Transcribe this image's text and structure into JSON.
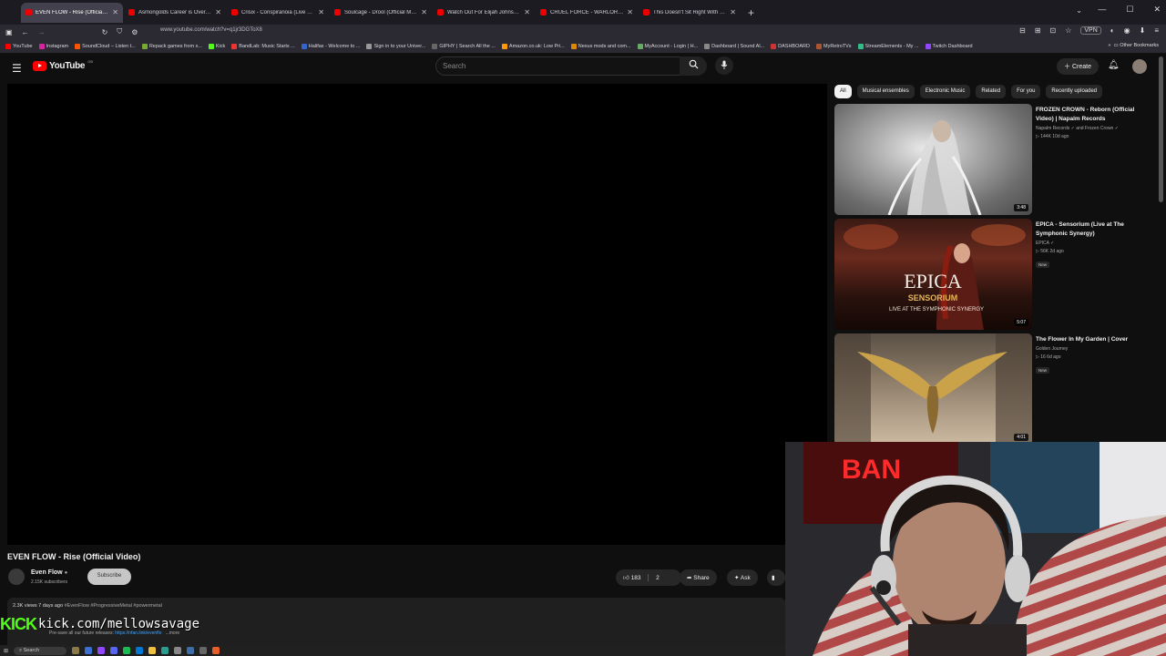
{
  "browser": {
    "tabs": [
      {
        "label": "EVEN FLOW - Rise (Official Vide",
        "active": true
      },
      {
        "label": "Asmongolds Career is Over... - Y"
      },
      {
        "label": "Crisix - Conspiranoia (Live From"
      },
      {
        "label": "Soulcage - Drool (Official Music"
      },
      {
        "label": "Watch Out For Elijah Johnson | "
      },
      {
        "label": "CRUEL FORCE - WARLORDS (O"
      },
      {
        "label": "This Doesn't Sit Right With Me"
      }
    ],
    "url": "www.youtube.com/watch?v=q1jr3DGToX8",
    "vpn_label": "VPN",
    "bookmarks": [
      "YouTube",
      "Instagram",
      "SoundCloud – Listen t...",
      "Repack games from x...",
      "Kick",
      "BandLab: Music Starts ...",
      "Halifax - Welcome to ...",
      "Sign in to your Univer...",
      "GIPHY | Search All the ...",
      "Amazon.co.uk: Low Pri...",
      "Nexus mods and com...",
      "MyAccount - Login | H...",
      "Dashboard | Sound Al...",
      "DASHBOARD",
      "MyRetroTVs",
      "StreamElements - My ...",
      "Twitch Dashboard"
    ],
    "other_bookmarks": "Other Bookmarks"
  },
  "youtube": {
    "logo_text": "YouTube",
    "logo_region": "GB",
    "search_placeholder": "Search",
    "create_label": "Create"
  },
  "video": {
    "title": "EVEN FLOW - Rise (Official Video)",
    "channel": "Even Flow",
    "subscribers": "2.15K subscribers",
    "subscribe_label": "Subscribe",
    "likes": "183",
    "comments": "2",
    "share_label": "Share",
    "ask_label": "Ask",
    "views_date": "2.3K views  7 days ago",
    "hashtags": "#EvenFlow #ProgressiveMetal #powermetal",
    "desc_line": "Pre-save all our future releases: ",
    "desc_link": "https://nfan.link/evenflo",
    "desc_more": "...more"
  },
  "chips": [
    "All",
    "Musical ensembles",
    "Electronic Music",
    "Related",
    "For you",
    "Recently uploaded"
  ],
  "recommendations": [
    {
      "title": "FROZEN CROWN - Reborn (Official Video) | Napalm Records",
      "channel": "Napalm Records ✓ and Frozen Crown ✓",
      "meta": "▷ 144K  10d ago",
      "duration": "3:48",
      "badge": ""
    },
    {
      "title": "EPICA - Sensorium (Live at The Symphonic Synergy)",
      "channel": "EPICA ✓",
      "meta": "▷ 56K  2d ago",
      "duration": "5:07",
      "badge": "New",
      "thumb_text1": "EPICA",
      "thumb_text2": "SENSORIUM",
      "thumb_text3": "LIVE AT THE SYMPHONIC SYNERGY"
    },
    {
      "title": "The Flower In My Garden | Cover",
      "channel": "Golden Journey",
      "meta": "▷ 16  6d ago",
      "duration": "4:01",
      "badge": "New"
    }
  ],
  "overlay": {
    "kick_logo": "KICK",
    "kick_url": "kick.com/mellowsavage",
    "cam_sign": "BAN"
  },
  "taskbar": {
    "search": "Search"
  },
  "colors": {
    "yt_red": "#ff0000",
    "kick_green": "#53fc18",
    "link_blue": "#3ea6ff"
  }
}
